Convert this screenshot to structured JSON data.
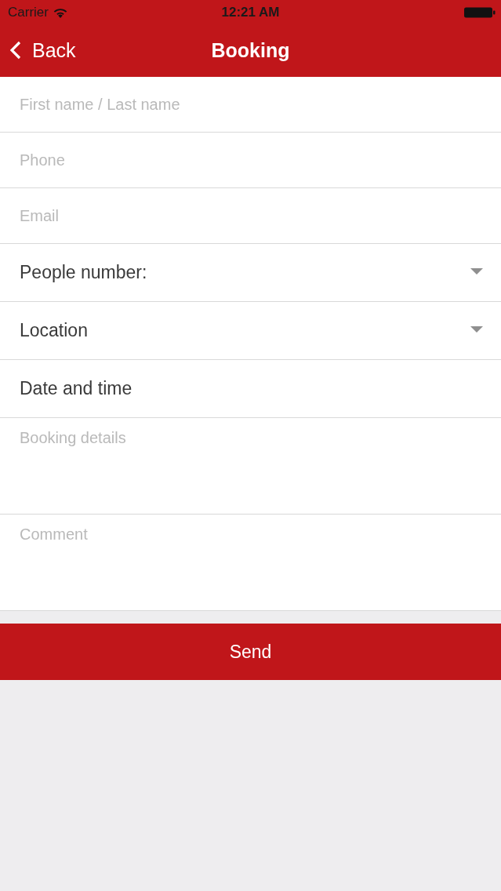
{
  "status_bar": {
    "carrier": "Carrier",
    "time": "12:21 AM"
  },
  "nav_bar": {
    "back": "Back",
    "title": "Booking"
  },
  "fields": [
    {
      "kind": "input",
      "placeholder": "First name / Last name"
    },
    {
      "kind": "input",
      "placeholder": "Phone"
    },
    {
      "kind": "input",
      "placeholder": "Email"
    },
    {
      "kind": "select",
      "value": "People number:"
    },
    {
      "kind": "select",
      "value": "Location"
    },
    {
      "kind": "picker",
      "value": "Date and time"
    },
    {
      "kind": "textarea",
      "placeholder": "Booking details"
    },
    {
      "kind": "textarea",
      "placeholder": "Comment"
    }
  ],
  "send_button": "Send"
}
